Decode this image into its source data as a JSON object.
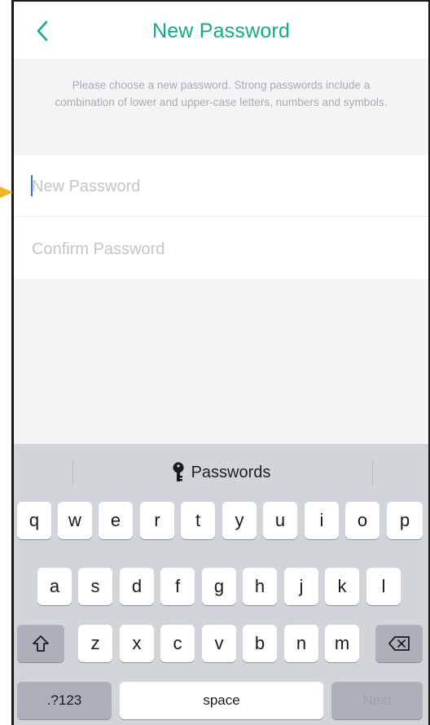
{
  "navbar": {
    "title": "New Password",
    "back_icon": "chevron-left-icon"
  },
  "info": {
    "text": "Please choose a new password. Strong passwords include a combination of lower and upper-case letters, numbers and symbols."
  },
  "form": {
    "new_password_placeholder": "New Password",
    "confirm_password_placeholder": "Confirm Password"
  },
  "keyboard": {
    "suggestion": "Passwords",
    "suggestion_icon": "key-icon",
    "row1": [
      "q",
      "w",
      "e",
      "r",
      "t",
      "y",
      "u",
      "i",
      "o",
      "p"
    ],
    "row2": [
      "a",
      "s",
      "d",
      "f",
      "g",
      "h",
      "j",
      "k",
      "l"
    ],
    "row3": [
      "z",
      "x",
      "c",
      "v",
      "b",
      "n",
      "m"
    ],
    "shift_icon": "shift-icon",
    "delete_icon": "backspace-icon",
    "numbers_label": ".?123",
    "space_label": "space",
    "next_label": "Next"
  },
  "colors": {
    "accent": "#14a98c",
    "pointer": "#f0b529",
    "caret": "#3a6fe0"
  }
}
